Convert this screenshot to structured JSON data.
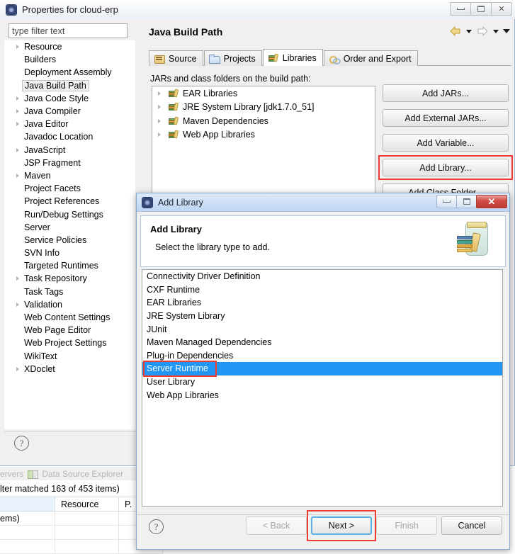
{
  "properties_window": {
    "title": "Properties for cloud-erp",
    "icon": "eclipse-icon",
    "window_controls": {
      "minimize": "minimize-icon",
      "maximize": "maximize-icon",
      "close": "close-icon"
    },
    "filter": {
      "placeholder": "type filter text",
      "value": ""
    },
    "tree_items": [
      {
        "label": "Resource",
        "expandable": true,
        "selected": false
      },
      {
        "label": "Builders",
        "expandable": false,
        "selected": false
      },
      {
        "label": "Deployment Assembly",
        "expandable": false,
        "selected": false
      },
      {
        "label": "Java Build Path",
        "expandable": false,
        "selected": true
      },
      {
        "label": "Java Code Style",
        "expandable": true,
        "selected": false
      },
      {
        "label": "Java Compiler",
        "expandable": true,
        "selected": false
      },
      {
        "label": "Java Editor",
        "expandable": true,
        "selected": false
      },
      {
        "label": "Javadoc Location",
        "expandable": false,
        "selected": false
      },
      {
        "label": "JavaScript",
        "expandable": true,
        "selected": false
      },
      {
        "label": "JSP Fragment",
        "expandable": false,
        "selected": false
      },
      {
        "label": "Maven",
        "expandable": true,
        "selected": false
      },
      {
        "label": "Project Facets",
        "expandable": false,
        "selected": false
      },
      {
        "label": "Project References",
        "expandable": false,
        "selected": false
      },
      {
        "label": "Run/Debug Settings",
        "expandable": false,
        "selected": false
      },
      {
        "label": "Server",
        "expandable": false,
        "selected": false
      },
      {
        "label": "Service Policies",
        "expandable": false,
        "selected": false
      },
      {
        "label": "SVN Info",
        "expandable": false,
        "selected": false
      },
      {
        "label": "Targeted Runtimes",
        "expandable": false,
        "selected": false
      },
      {
        "label": "Task Repository",
        "expandable": true,
        "selected": false
      },
      {
        "label": "Task Tags",
        "expandable": false,
        "selected": false
      },
      {
        "label": "Validation",
        "expandable": true,
        "selected": false
      },
      {
        "label": "Web Content Settings",
        "expandable": false,
        "selected": false
      },
      {
        "label": "Web Page Editor",
        "expandable": false,
        "selected": false
      },
      {
        "label": "Web Project Settings",
        "expandable": false,
        "selected": false
      },
      {
        "label": "WikiText",
        "expandable": false,
        "selected": false
      },
      {
        "label": "XDoclet",
        "expandable": true,
        "selected": false
      }
    ],
    "help_glyph": "?",
    "page": {
      "title": "Java Build Path",
      "nav": {
        "back_icon": "back-arrow-icon",
        "back_menu_icon": "chevron-down-icon",
        "forward_icon": "forward-arrow-icon",
        "forward_menu_icon": "chevron-down-icon",
        "view_menu_icon": "chevron-down-icon"
      },
      "tabs": [
        {
          "label": "Source",
          "icon": "source-folder-icon",
          "active": false
        },
        {
          "label": "Projects",
          "icon": "projects-folder-icon",
          "active": false
        },
        {
          "label": "Libraries",
          "icon": "libraries-icon",
          "active": true
        },
        {
          "label": "Order and Export",
          "icon": "order-export-icon",
          "active": false
        }
      ],
      "tree_label": "JARs and class folders on the build path:",
      "jars": [
        {
          "label": "EAR Libraries",
          "icon": "library-icon"
        },
        {
          "label": "JRE System Library [jdk1.7.0_51]",
          "icon": "library-icon"
        },
        {
          "label": "Maven Dependencies",
          "icon": "library-icon"
        },
        {
          "label": "Web App Libraries",
          "icon": "library-icon"
        }
      ],
      "buttons": [
        {
          "label": "Add JARs...",
          "highlighted": false
        },
        {
          "label": "Add External JARs...",
          "highlighted": false
        },
        {
          "label": "Add Variable...",
          "highlighted": false
        },
        {
          "label": "Add Library...",
          "highlighted": true
        },
        {
          "label": "Add Class Folder...",
          "highlighted": false
        }
      ]
    }
  },
  "workbench_background": {
    "view_tabs": [
      {
        "label": "ervers",
        "icon": ""
      },
      {
        "label": "Data Source Explorer",
        "icon": "data-source-explorer-icon"
      }
    ],
    "filter_status": "lter matched 163 of 453 items)",
    "table_headers": [
      "",
      "Resource",
      "P."
    ],
    "table_rows": [
      [
        "ems)",
        "",
        ""
      ],
      [
        "",
        "",
        ""
      ],
      [
        "",
        "",
        ""
      ]
    ]
  },
  "add_library_dialog": {
    "title": "Add Library",
    "icon": "eclipse-icon",
    "window_controls": {
      "minimize": "minimize-icon",
      "maximize": "maximize-icon",
      "close": "close-icon"
    },
    "banner": {
      "heading": "Add Library",
      "subtitle": "Select the library type to add.",
      "icon": "jar-with-books-icon"
    },
    "list_items": [
      {
        "label": "Connectivity Driver Definition",
        "selected": false
      },
      {
        "label": "CXF Runtime",
        "selected": false
      },
      {
        "label": "EAR Libraries",
        "selected": false
      },
      {
        "label": "JRE System Library",
        "selected": false
      },
      {
        "label": "JUnit",
        "selected": false
      },
      {
        "label": "Maven Managed Dependencies",
        "selected": false
      },
      {
        "label": "Plug-in Dependencies",
        "selected": false
      },
      {
        "label": "Server Runtime",
        "selected": true
      },
      {
        "label": "User Library",
        "selected": false
      },
      {
        "label": "Web App Libraries",
        "selected": false
      }
    ],
    "help_glyph": "?",
    "buttons": [
      {
        "label": "< Back",
        "enabled": false,
        "default": false,
        "highlighted": false
      },
      {
        "label": "Next >",
        "enabled": true,
        "default": true,
        "highlighted": true
      },
      {
        "label": "Finish",
        "enabled": false,
        "default": false,
        "highlighted": false
      },
      {
        "label": "Cancel",
        "enabled": true,
        "default": false,
        "highlighted": false
      }
    ]
  },
  "colors": {
    "selection_blue": "#2196f3",
    "highlight_red": "#ee3b33",
    "dialog_title_blue": "#cfe1f7",
    "close_red": "#d4504a"
  }
}
